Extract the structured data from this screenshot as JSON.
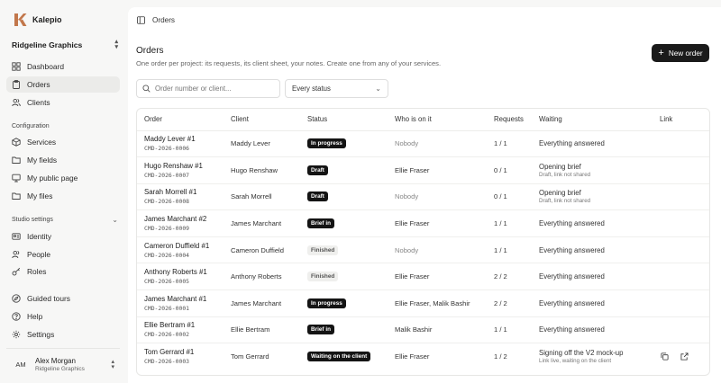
{
  "app": {
    "name": "Kalepio"
  },
  "workspace": {
    "name": "Ridgeline Graphics"
  },
  "nav": {
    "main": [
      {
        "label": "Dashboard",
        "icon": "grid-icon"
      },
      {
        "label": "Orders",
        "icon": "clipboard-icon",
        "active": true
      },
      {
        "label": "Clients",
        "icon": "users-icon"
      }
    ],
    "configuration_label": "Configuration",
    "configuration": [
      {
        "label": "Services",
        "icon": "box-icon"
      },
      {
        "label": "My fields",
        "icon": "folder-icon"
      },
      {
        "label": "My public page",
        "icon": "monitor-icon"
      },
      {
        "label": "My files",
        "icon": "folder-icon"
      }
    ],
    "studio_label": "Studio settings",
    "studio": [
      {
        "label": "Identity",
        "icon": "id-icon"
      },
      {
        "label": "People",
        "icon": "people-icon"
      },
      {
        "label": "Roles",
        "icon": "key-icon"
      }
    ],
    "bottom": [
      {
        "label": "Guided tours",
        "icon": "compass-icon"
      },
      {
        "label": "Help",
        "icon": "help-icon"
      },
      {
        "label": "Settings",
        "icon": "gear-icon"
      }
    ]
  },
  "user": {
    "initials": "AM",
    "name": "Alex Morgan",
    "org": "Ridgeline Graphics"
  },
  "topbar": {
    "breadcrumb": "Orders"
  },
  "page": {
    "title": "Orders",
    "subtitle": "One order per project: its requests, its client sheet, your notes. Create one from any of your services.",
    "new_button": "New order"
  },
  "filters": {
    "search_placeholder": "Order number or client...",
    "status_value": "Every status"
  },
  "table": {
    "headers": {
      "order": "Order",
      "client": "Client",
      "status": "Status",
      "who": "Who is on it",
      "requests": "Requests",
      "waiting": "Waiting",
      "link": "Link"
    },
    "rows": [
      {
        "name": "Maddy Lever #1",
        "code": "CMD-2026-0006",
        "client": "Maddy Lever",
        "status": "In progress",
        "status_style": "dark",
        "who": "Nobody",
        "who_muted": true,
        "requests": "1 / 1",
        "waiting": "Everything answered",
        "waiting_muted": true,
        "waiting_sub": "",
        "links": false
      },
      {
        "name": "Hugo Renshaw #1",
        "code": "CMD-2026-0007",
        "client": "Hugo Renshaw",
        "status": "Draft",
        "status_style": "dark",
        "who": "Ellie Fraser",
        "who_muted": false,
        "requests": "0 / 1",
        "waiting": "Opening brief",
        "waiting_muted": false,
        "waiting_sub": "Draft, link not shared",
        "links": false
      },
      {
        "name": "Sarah Morrell #1",
        "code": "CMD-2026-0008",
        "client": "Sarah Morrell",
        "status": "Draft",
        "status_style": "dark",
        "who": "Nobody",
        "who_muted": true,
        "requests": "0 / 1",
        "waiting": "Opening brief",
        "waiting_muted": false,
        "waiting_sub": "Draft, link not shared",
        "links": false
      },
      {
        "name": "James Marchant #2",
        "code": "CMD-2026-0009",
        "client": "James Marchant",
        "status": "Brief in",
        "status_style": "dark",
        "who": "Ellie Fraser",
        "who_muted": false,
        "requests": "1 / 1",
        "waiting": "Everything answered",
        "waiting_muted": true,
        "waiting_sub": "",
        "links": false
      },
      {
        "name": "Cameron Duffield #1",
        "code": "CMD-2026-0004",
        "client": "Cameron Duffield",
        "status": "Finished",
        "status_style": "light",
        "who": "Nobody",
        "who_muted": true,
        "requests": "1 / 1",
        "waiting": "Everything answered",
        "waiting_muted": true,
        "waiting_sub": "",
        "links": false
      },
      {
        "name": "Anthony Roberts #1",
        "code": "CMD-2026-0005",
        "client": "Anthony Roberts",
        "status": "Finished",
        "status_style": "light",
        "who": "Ellie Fraser",
        "who_muted": false,
        "requests": "2 / 2",
        "waiting": "Everything answered",
        "waiting_muted": true,
        "waiting_sub": "",
        "links": false
      },
      {
        "name": "James Marchant #1",
        "code": "CMD-2026-0001",
        "client": "James Marchant",
        "status": "In progress",
        "status_style": "dark",
        "who": "Ellie Fraser, Malik Bashir",
        "who_muted": false,
        "requests": "2 / 2",
        "waiting": "Everything answered",
        "waiting_muted": true,
        "waiting_sub": "",
        "links": false
      },
      {
        "name": "Ellie Bertram #1",
        "code": "CMD-2026-0002",
        "client": "Ellie Bertram",
        "status": "Brief in",
        "status_style": "dark",
        "who": "Malik Bashir",
        "who_muted": false,
        "requests": "1 / 1",
        "waiting": "Everything answered",
        "waiting_muted": true,
        "waiting_sub": "",
        "links": false
      },
      {
        "name": "Tom Gerrard #1",
        "code": "CMD-2026-0003",
        "client": "Tom Gerrard",
        "status": "Waiting on the client",
        "status_style": "dark",
        "who": "Ellie Fraser",
        "who_muted": false,
        "requests": "1 / 2",
        "waiting": "Signing off the V2 mock-up",
        "waiting_muted": false,
        "waiting_sub": "Link live, waiting on the client",
        "links": true
      }
    ]
  },
  "colors": {
    "accent": "#c2774b",
    "primary_button": "#1a1a1a",
    "sidebar_bg": "#f7f7f6"
  }
}
